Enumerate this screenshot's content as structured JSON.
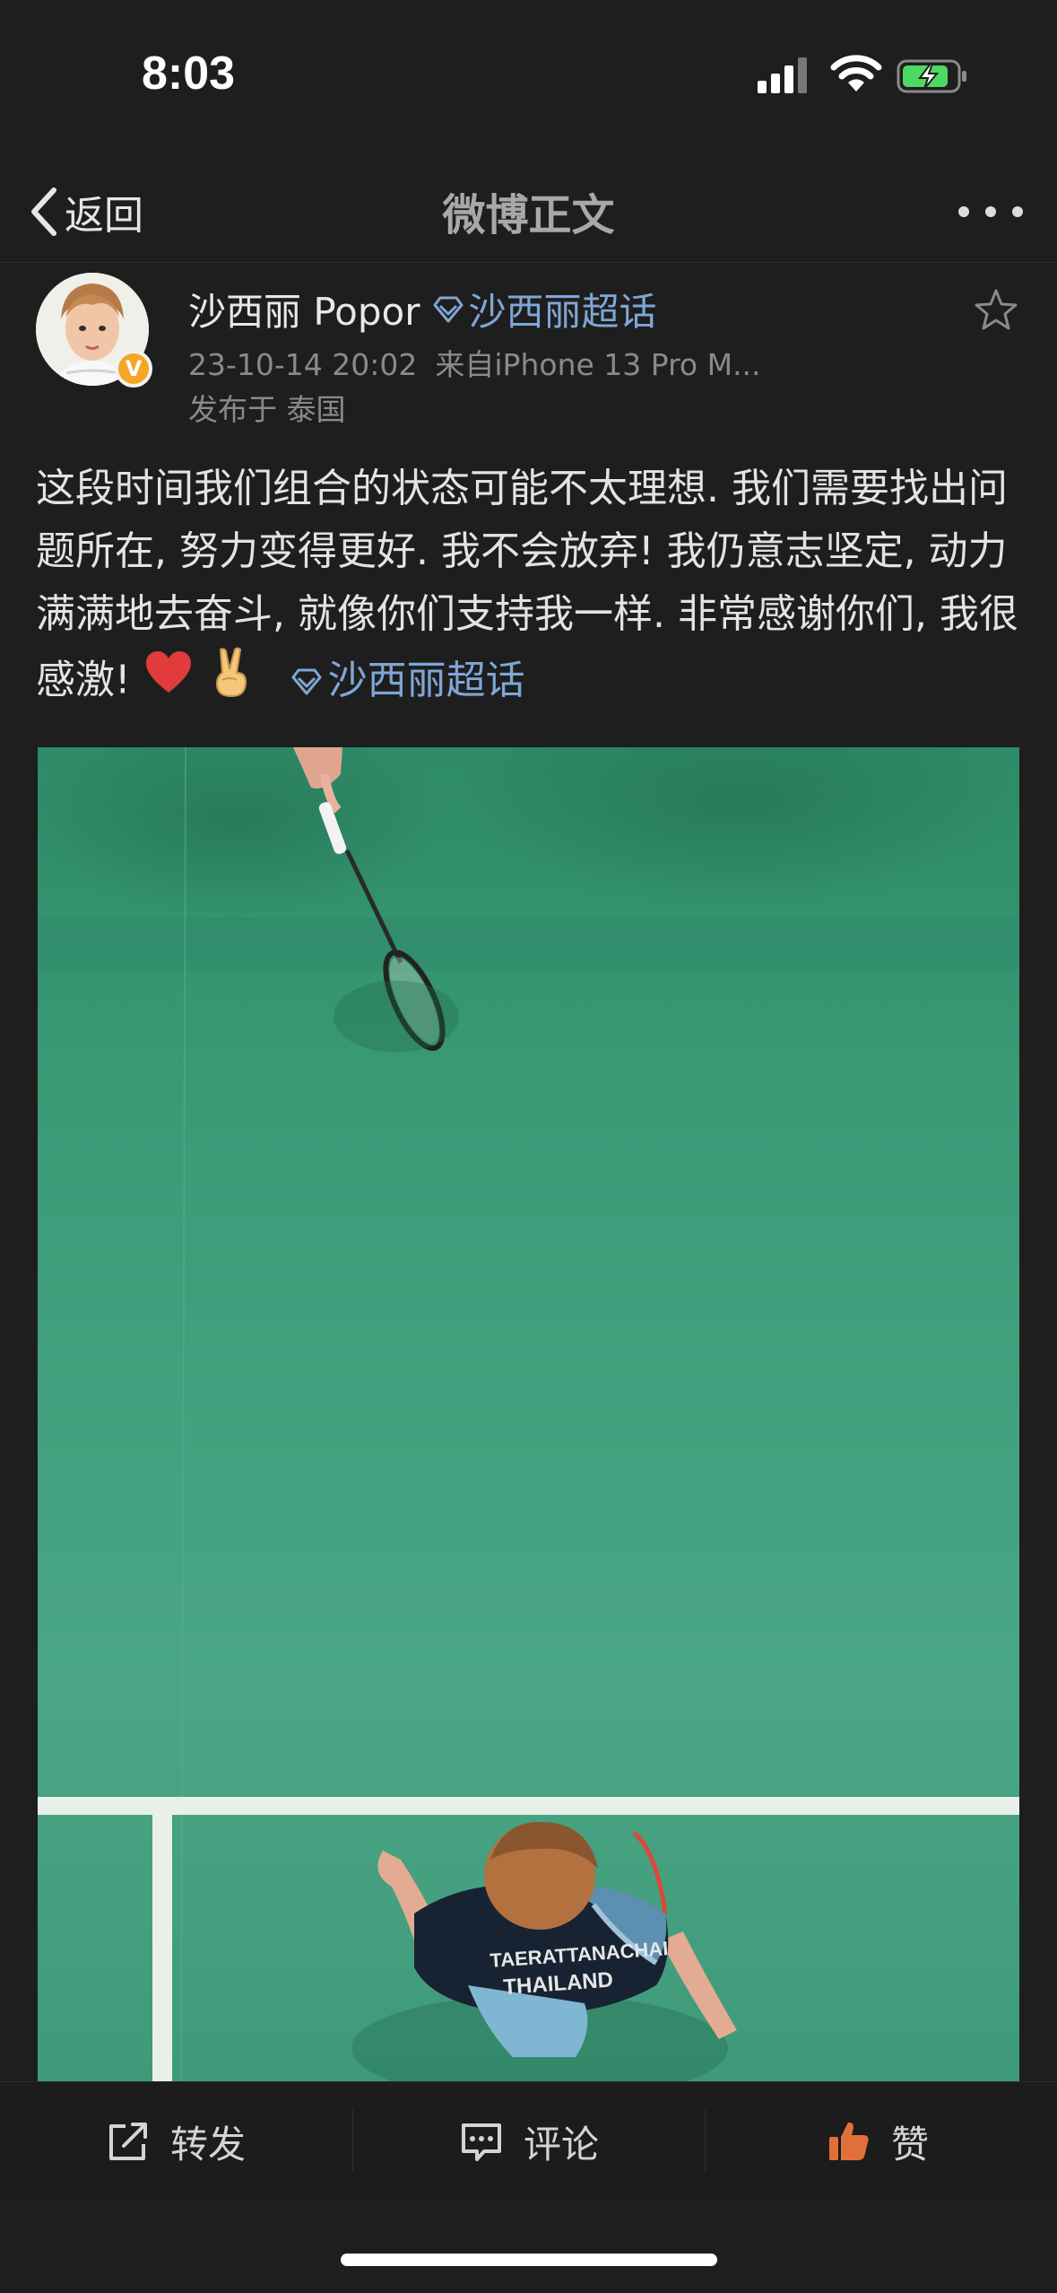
{
  "status_bar": {
    "time": "8:03"
  },
  "nav": {
    "back_label": "返回",
    "title": "微博正文"
  },
  "post": {
    "username": "沙西丽 Popor",
    "topic_link": "沙西丽超话",
    "timestamp": "23-10-14 20:02",
    "source": "来自iPhone 13 Pro M...",
    "location": "发布于 泰国",
    "verified_badge": "V",
    "text": "这段时间我们组合的状态可能不太理想. 我们需要找出问题所在, 努力变得更好. 我不会放弃! 我仍意志坚定, 动力满满地去奋斗, 就像你们支持我一样. 非常感谢你们, 我很感激! ",
    "text_emojis": [
      "❤️",
      "✌️"
    ],
    "text_topic": "沙西丽超话",
    "photo_jersey_text": [
      "TAERATTANACHAI",
      "THAILAND"
    ]
  },
  "toolbar": {
    "repost": "转发",
    "comment": "评论",
    "like": "赞"
  },
  "colors": {
    "background": "#1e1e1e",
    "link": "#7fa6d6",
    "court_green": "#3f9f7f",
    "like_orange": "#e0703a",
    "battery_green": "#4cd964"
  }
}
